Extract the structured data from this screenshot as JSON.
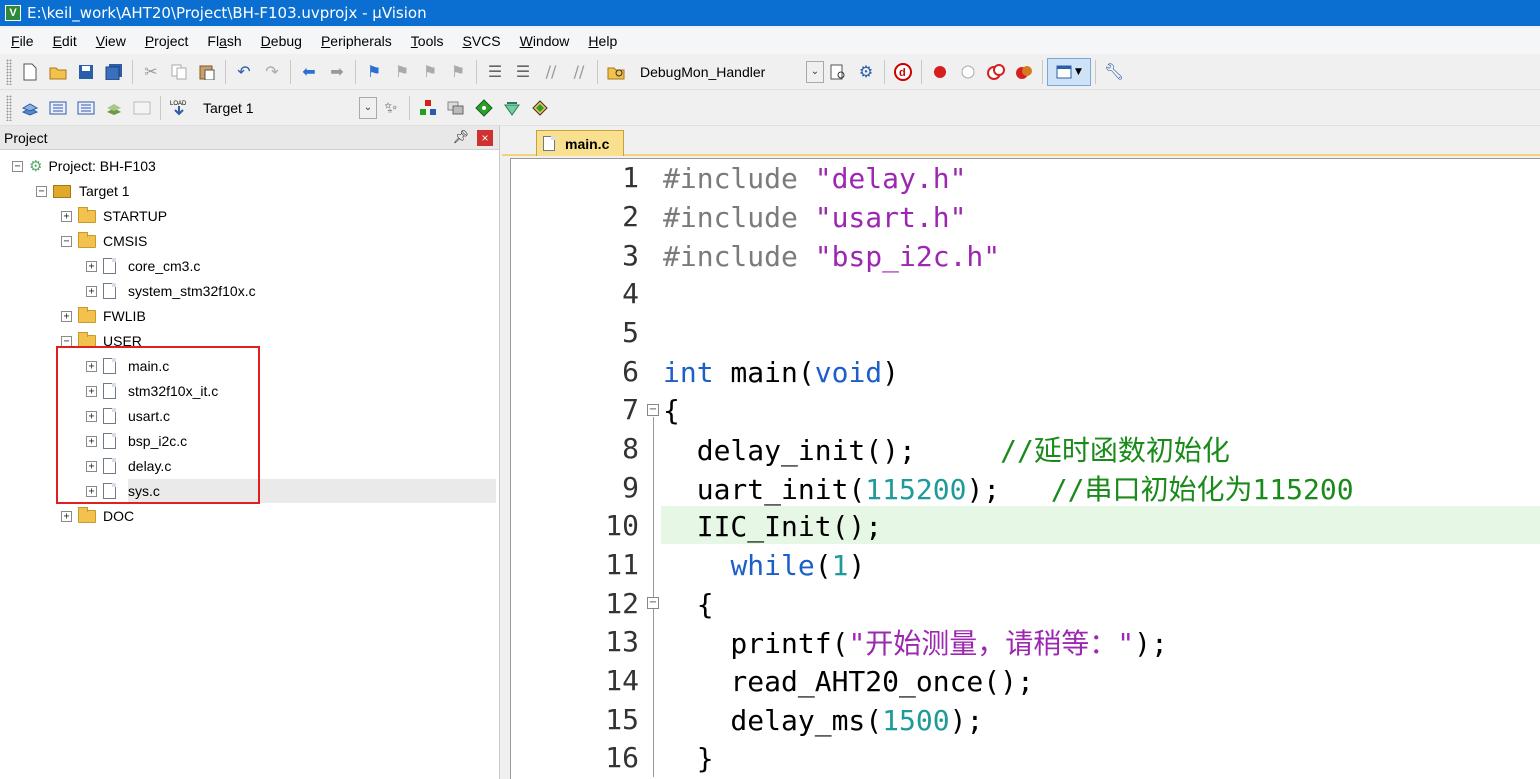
{
  "window": {
    "title": "E:\\keil_work\\AHT20\\Project\\BH-F103.uvprojx - µVision"
  },
  "menu": [
    {
      "label": "File",
      "u": "F",
      "rest": "ile"
    },
    {
      "label": "Edit",
      "u": "E",
      "rest": "dit"
    },
    {
      "label": "View",
      "u": "V",
      "rest": "iew"
    },
    {
      "label": "Project",
      "u": "P",
      "rest": "roject"
    },
    {
      "label": "Flash",
      "pre": "Fl",
      "u": "a",
      "rest": "sh"
    },
    {
      "label": "Debug",
      "u": "D",
      "rest": "ebug"
    },
    {
      "label": "Peripherals",
      "u": "P",
      "rest": "eripherals"
    },
    {
      "label": "Tools",
      "u": "T",
      "rest": "ools"
    },
    {
      "label": "SVCS",
      "u": "S",
      "rest": "VCS"
    },
    {
      "label": "Window",
      "u": "W",
      "rest": "indow"
    },
    {
      "label": "Help",
      "u": "H",
      "rest": "elp"
    }
  ],
  "toolbar": {
    "function_combo": "DebugMon_Handler",
    "target_combo": "Target 1"
  },
  "project_panel": {
    "title": "Project",
    "pin": "ᵖ",
    "close": "×",
    "project_name": "Project: BH-F103",
    "target_name": "Target 1",
    "groups": {
      "startup": "STARTUP",
      "cmsis": "CMSIS",
      "fwlib": "FWLIB",
      "user": "USER",
      "doc": "DOC"
    },
    "cmsis_files": [
      "core_cm3.c",
      "system_stm32f10x.c"
    ],
    "user_files": [
      "main.c",
      "stm32f10x_it.c",
      "usart.c",
      "bsp_i2c.c",
      "delay.c",
      "sys.c"
    ]
  },
  "editor": {
    "active_tab": "main.c",
    "current_line": 10,
    "line_numbers": [
      "1",
      "2",
      "3",
      "4",
      "5",
      "6",
      "7",
      "8",
      "9",
      "10",
      "11",
      "12",
      "13",
      "14",
      "15",
      "16"
    ]
  },
  "code": {
    "l1_pp": "#include ",
    "l1_str": "\"delay.h\"",
    "l2_pp": "#include ",
    "l2_str": "\"usart.h\"",
    "l3_pp": "#include ",
    "l3_str": "\"bsp_i2c.h\"",
    "l6_kw1": "int",
    "l6_mid": " main(",
    "l6_kw2": "void",
    "l6_end": ")",
    "l7": "{",
    "l8_code": "  delay_init();     ",
    "l8_cmt": "//延时函数初始化",
    "l9_code": "  uart_init(",
    "l9_num": "115200",
    "l9_end": ");   ",
    "l9_cmt": "//串口初始化为115200",
    "l10": "  IIC_Init();",
    "l11_pre": "    ",
    "l11_kw": "while",
    "l11_mid": "(",
    "l11_num": "1",
    "l11_end": ")",
    "l12": "  {",
    "l13_pre": "    printf(",
    "l13_str": "\"开始测量，请稍等：\"",
    "l13_end": ");",
    "l14": "    read_AHT20_once();",
    "l15_pre": "    delay_ms(",
    "l15_num": "1500",
    "l15_end": ");",
    "l16": "  }"
  },
  "colors": {
    "titlebar": "#0a6fd0",
    "highlight_box": "#e02020",
    "current_line": "#e6f7e6",
    "keyword": "#1d5fc9",
    "string": "#9c27b0",
    "comment": "#1a8a1a",
    "number": "#1e9a9a"
  }
}
